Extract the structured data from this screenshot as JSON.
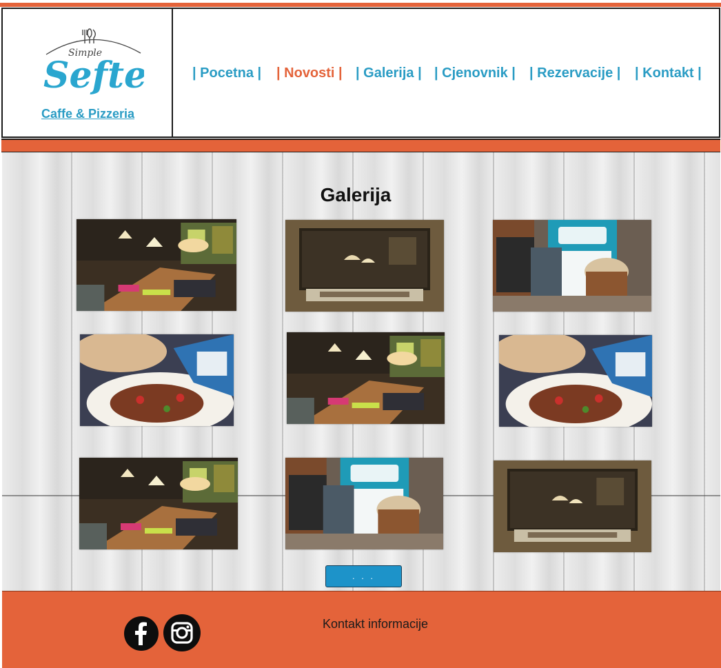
{
  "colors": {
    "accent": "#e4633a",
    "link": "#2a9cc4",
    "button": "#1d93c9"
  },
  "header": {
    "logo": {
      "top_word": "Simple",
      "main_word": "Sefte",
      "subtitle": "Caffe & Pizzeria"
    },
    "nav": [
      {
        "label": "| Pocetna |",
        "active": false
      },
      {
        "label": "| Novosti |",
        "active": true
      },
      {
        "label": "| Galerija |",
        "active": false
      },
      {
        "label": "| Cjenovnik |",
        "active": false
      },
      {
        "label": "| Rezervacije |",
        "active": false
      },
      {
        "label": "| Kontakt |",
        "active": false
      }
    ]
  },
  "gallery": {
    "title": "Galerija",
    "photos": [
      {
        "subject": "restaurant-interior"
      },
      {
        "subject": "window-view"
      },
      {
        "subject": "coffee-menu"
      },
      {
        "subject": "food-plate"
      },
      {
        "subject": "restaurant-interior"
      },
      {
        "subject": "food-plate"
      },
      {
        "subject": "restaurant-interior"
      },
      {
        "subject": "coffee-menu"
      },
      {
        "subject": "window-view"
      }
    ],
    "more_button": ". . ."
  },
  "footer": {
    "social": [
      {
        "icon": "facebook-icon"
      },
      {
        "icon": "instagram-icon"
      }
    ],
    "contact_label": "Kontakt informacije"
  }
}
